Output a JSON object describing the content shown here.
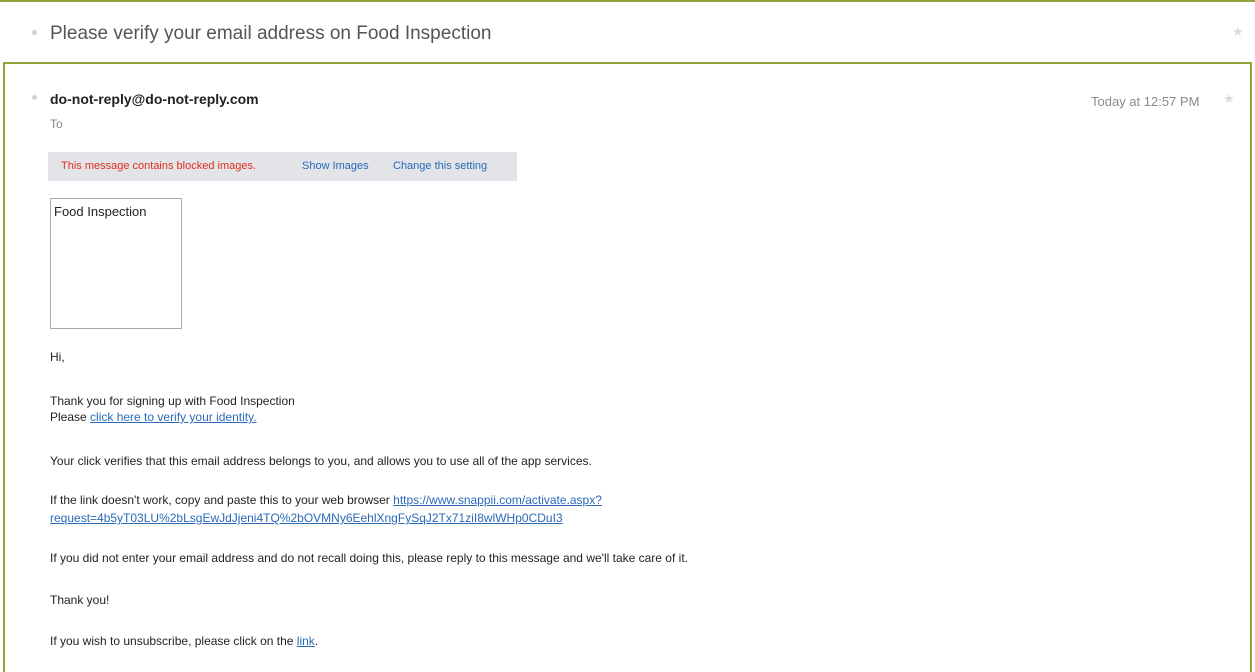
{
  "thread": {
    "subject": "Please verify your email address on Food Inspection",
    "star_icon": "★"
  },
  "message": {
    "sender": "do-not-reply@do-not-reply.com",
    "to_label": "To",
    "date": "Today at 12:57 PM",
    "star_icon": "★"
  },
  "blocked_bar": {
    "text": "This message contains blocked images.",
    "show_images": "Show Images",
    "change_setting": "Change this setting"
  },
  "image_placeholder": {
    "alt_text": "Food Inspection"
  },
  "body": {
    "greeting": "Hi,",
    "thanks_line": "Thank you for signing up with Food Inspection",
    "please_prefix": "Please ",
    "verify_link": "click here to verify your identity.",
    "verify_explanation": "Your click verifies that this email address belongs to you, and allows you to use all of the app services.",
    "fallback_prefix": "If the link doesn't work, copy and paste this to your web browser ",
    "fallback_url_part1": "https://www.snappii.com/activate.aspx?",
    "fallback_url_part2": "request=4b5yT03LU%2bLsgEwJdJjeni4TQ%2bOVMNy6EehlXngFySqJ2Tx71ziI8wlWHp0CDuI3",
    "not_you_line": "If you did not enter your email address and do not recall doing this, please reply to this message and we'll take care of it.",
    "sign_off": "Thank you!",
    "unsubscribe_prefix": "If you wish to unsubscribe, please click on the ",
    "unsubscribe_link": "link",
    "unsubscribe_suffix": "."
  },
  "colors": {
    "accent_border": "#8fa739",
    "link": "#2a6ab8",
    "warning": "#e0301e",
    "muted": "#8a8a8a"
  }
}
